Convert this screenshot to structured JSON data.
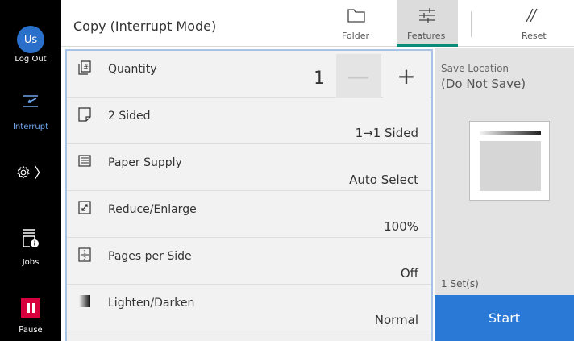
{
  "sidebar": {
    "avatar_text": "Us",
    "logout_label": "Log Out",
    "interrupt_label": "Interrupt",
    "jobs_label": "Jobs",
    "pause_label": "Pause",
    "chevron": "〉"
  },
  "header": {
    "title": "Copy (Interrupt Mode)",
    "folder_label": "Folder",
    "features_label": "Features",
    "reset_label": "Reset"
  },
  "settings": {
    "quantity": {
      "label": "Quantity",
      "value": "1",
      "minus": "—",
      "plus": "+"
    },
    "sided": {
      "label": "2 Sided",
      "value": "1→1 Sided"
    },
    "paper": {
      "label": "Paper Supply",
      "value": "Auto Select"
    },
    "reduce": {
      "label": "Reduce/Enlarge",
      "value": "100%"
    },
    "pages": {
      "label": "Pages per Side",
      "value": "Off"
    },
    "lighten": {
      "label": "Lighten/Darken",
      "value": "Normal"
    }
  },
  "preview": {
    "save_location_label": "Save Location",
    "save_location_value": "(Do Not Save)",
    "sets": "1 Set(s)",
    "start_label": "Start"
  },
  "colors": {
    "avatar": "#2a6fc9",
    "interrupt_text": "#6ea4ea",
    "pause": "#d5003c",
    "start": "#2a79d6",
    "features_underline": "#0a8c7c"
  }
}
